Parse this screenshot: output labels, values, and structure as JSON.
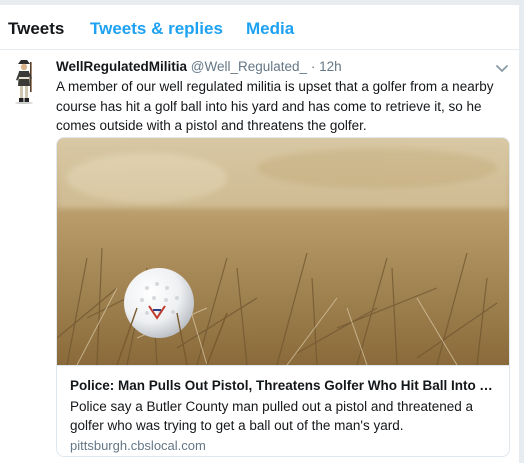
{
  "tabs": [
    {
      "label": "Tweets"
    },
    {
      "label": "Tweets & replies"
    },
    {
      "label": "Media"
    }
  ],
  "tweet": {
    "display_name": "WellRegulatedMilitia",
    "handle": "@Well_Regulated_",
    "separator": "·",
    "time": "12h",
    "text": "A member of our well regulated militia is upset that a golfer from a nearby course has hit a golf ball into his yard and has come to retrieve it, so he comes outside with a pistol and threatens the golfer.",
    "card": {
      "title": "Police: Man Pulls Out Pistol, Threatens Golfer Who Hit Ball Into Y...",
      "description": "Police say a Butler County man pulled out a pistol and threatened a golfer who was trying to get a ball out of the man's yard.",
      "domain": "pittsburgh.cbslocal.com"
    }
  },
  "colors": {
    "accent": "#1da1f2",
    "text": "#14171a",
    "muted": "#657786",
    "background": "#e6ecf0"
  }
}
